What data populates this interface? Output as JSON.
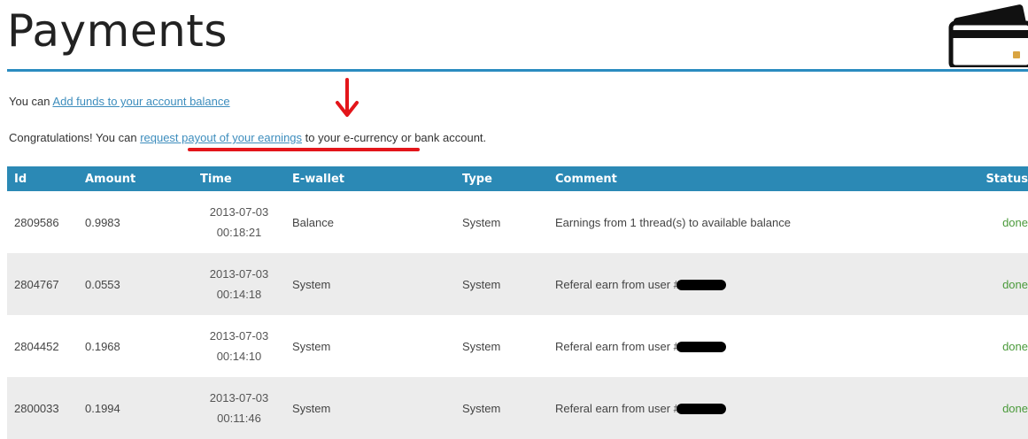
{
  "header": {
    "title": "Payments",
    "icon": "credit-card-icon"
  },
  "notices": {
    "add_funds_prefix": "You can",
    "add_funds_link": "Add funds to your account balance",
    "payout_prefix": "Congratulations! You can",
    "payout_link": "request payout of your earnings",
    "payout_suffix": "to your e-currency or bank account."
  },
  "annotations": {
    "arrow_color": "#e3151a",
    "underline_color": "#e3151a"
  },
  "table": {
    "columns": [
      "Id",
      "Amount",
      "Time",
      "E-wallet",
      "Type",
      "Comment",
      "Status"
    ],
    "rows": [
      {
        "id": "2809586",
        "amount": "0.9983",
        "date": "2013-07-03",
        "time": "00:18:21",
        "ewallet": "Balance",
        "type": "System",
        "comment": "Earnings from 1 thread(s) to available balance",
        "status": "done"
      },
      {
        "id": "2804767",
        "amount": "0.0553",
        "date": "2013-07-03",
        "time": "00:14:18",
        "ewallet": "System",
        "type": "System",
        "comment": "Referal earn from user #",
        "status": "done"
      },
      {
        "id": "2804452",
        "amount": "0.1968",
        "date": "2013-07-03",
        "time": "00:14:10",
        "ewallet": "System",
        "type": "System",
        "comment": "Referal earn from user #",
        "status": "done"
      },
      {
        "id": "2800033",
        "amount": "0.1994",
        "date": "2013-07-03",
        "time": "00:11:46",
        "ewallet": "System",
        "type": "System",
        "comment": "Referal earn from user #",
        "status": "done"
      }
    ]
  },
  "colors": {
    "accent": "#2b89b5",
    "link": "#3d8dbd",
    "status_done": "#4a9a3a"
  }
}
